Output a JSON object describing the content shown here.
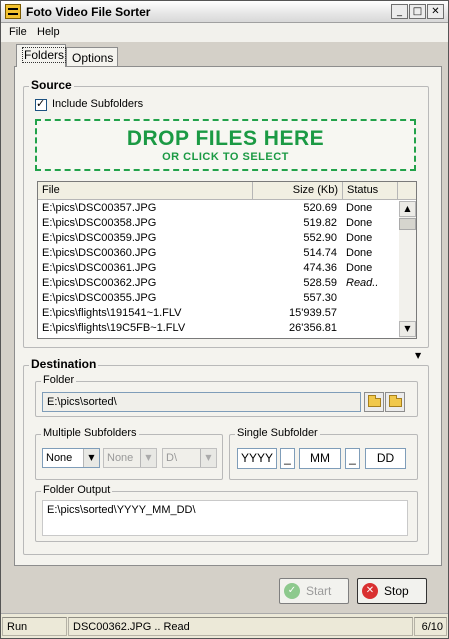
{
  "window": {
    "title": "Foto Video File Sorter",
    "minimize": "_",
    "maximize": "□",
    "close": "✕"
  },
  "menu": [
    "File",
    "Help"
  ],
  "tabs": [
    {
      "label": "Folders"
    },
    {
      "label": "Options"
    }
  ],
  "source": {
    "label": "Source",
    "include_subfolders": {
      "label": "Include Subfolders",
      "checked": true
    },
    "drop_title": "DROP FILES HERE",
    "drop_subtitle": "OR CLICK TO SELECT",
    "columns": [
      "File",
      "Size (Kb)",
      "Status"
    ],
    "files": [
      {
        "file": "E:\\pics\\DSC00357.JPG",
        "size": "520.69",
        "status": "Done"
      },
      {
        "file": "E:\\pics\\DSC00358.JPG",
        "size": "519.82",
        "status": "Done"
      },
      {
        "file": "E:\\pics\\DSC00359.JPG",
        "size": "552.90",
        "status": "Done"
      },
      {
        "file": "E:\\pics\\DSC00360.JPG",
        "size": "514.74",
        "status": "Done"
      },
      {
        "file": "E:\\pics\\DSC00361.JPG",
        "size": "474.36",
        "status": "Done"
      },
      {
        "file": "E:\\pics\\DSC00362.JPG",
        "size": "528.59",
        "status": "Read.."
      },
      {
        "file": "E:\\pics\\DSC00355.JPG",
        "size": "557.30",
        "status": ""
      },
      {
        "file": "E:\\pics\\flights\\191541~1.FLV",
        "size": "15'939.57",
        "status": ""
      },
      {
        "file": "E:\\pics\\flights\\19C5FB~1.FLV",
        "size": "26'356.81",
        "status": ""
      }
    ]
  },
  "destination": {
    "label": "Destination",
    "folder_label": "Folder",
    "folder_value": "E:\\pics\\sorted\\",
    "multiple_subfolders": {
      "label": "Multiple Subfolders",
      "sel1": "None",
      "sel2": "None",
      "sel3": "D\\"
    },
    "single_subfolder": {
      "label": "Single Subfolder",
      "parts": [
        "YYYY",
        "_",
        "MM",
        "_",
        "DD"
      ]
    },
    "folder_output_label": "Folder Output",
    "folder_output_value": "E:\\pics\\sorted\\YYYY_MM_DD\\"
  },
  "buttons": {
    "start": "Start",
    "stop": "Stop"
  },
  "statusbar": {
    "state": "Run",
    "message": "DSC00362.JPG .. Read",
    "progress": "6/10"
  },
  "colors": {
    "drop_green": "#1b9a44",
    "start_icon": "#7fbf7f",
    "stop_icon": "#d93030"
  }
}
